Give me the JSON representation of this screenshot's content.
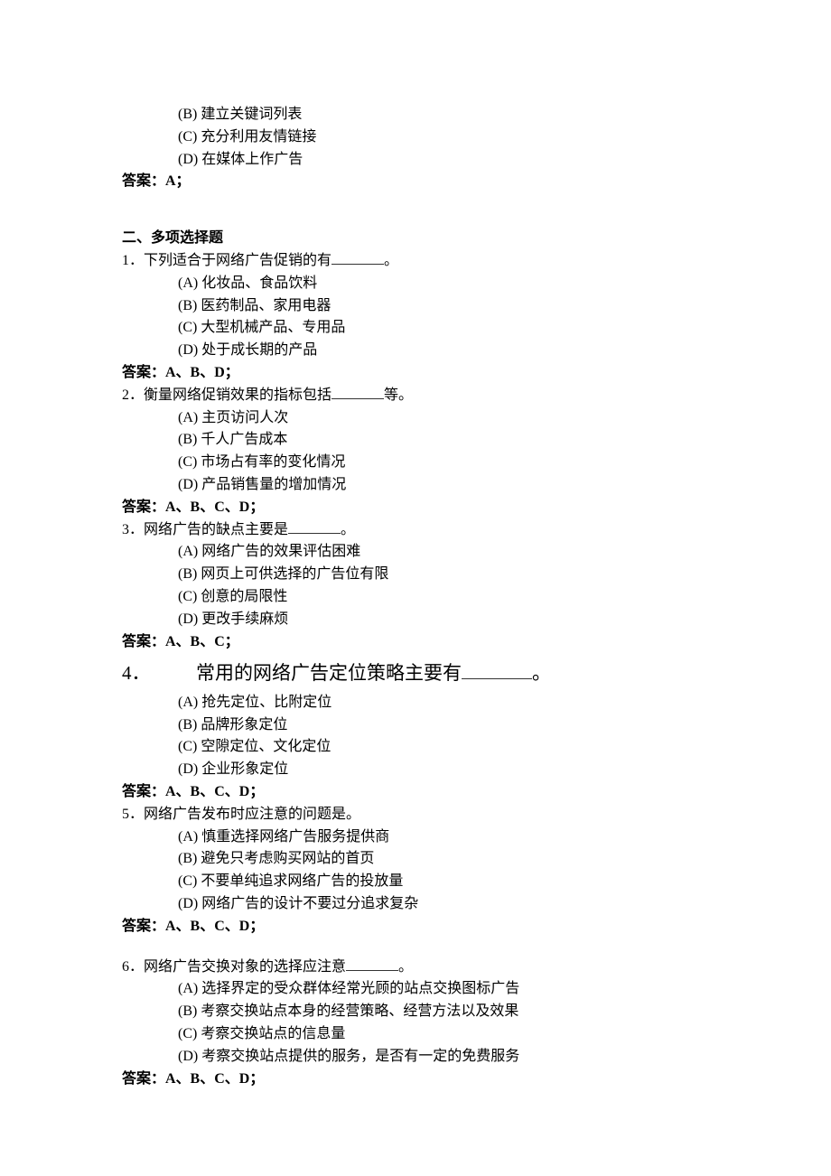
{
  "prev": {
    "options": {
      "B": "(B) 建立关键词列表",
      "C": "(C) 充分利用友情链接",
      "D": "(D) 在媒体上作广告"
    },
    "answer": "答案：A；"
  },
  "section2": {
    "title": "二、多项选择题",
    "q1": {
      "stem_pre": "1．下列适合于网络广告促销的有",
      "stem_post": "。",
      "options": {
        "A": "(A) 化妆品、食品饮料",
        "B": "(B) 医药制品、家用电器",
        "C": "(C) 大型机械产品、专用品",
        "D": "(D) 处于成长期的产品"
      },
      "answer": "答案：A、B、D；"
    },
    "q2": {
      "stem_pre": "2．衡量网络促销效果的指标包括",
      "stem_post": "等。",
      "options": {
        "A": "(A) 主页访问人次",
        "B": "(B) 千人广告成本",
        "C": "(C) 市场占有率的变化情况",
        "D": "(D) 产品销售量的增加情况"
      },
      "answer": "答案：A、B、C、D；"
    },
    "q3": {
      "stem_pre": "3．网络广告的缺点主要是",
      "stem_post": "。",
      "options": {
        "A": "(A) 网络广告的效果评估困难",
        "B": "(B) 网页上可供选择的广告位有限",
        "C": "(C) 创意的局限性",
        "D": "(D) 更改手续麻烦"
      },
      "answer": "答案：A、B、C；"
    },
    "q4": {
      "num": "4．",
      "stem_pre": "常用的网络广告定位策略主要有",
      "stem_post": "。",
      "options": {
        "A": "(A) 抢先定位、比附定位",
        "B": "(B) 品牌形象定位",
        "C": "(C) 空隙定位、文化定位",
        "D": "(D) 企业形象定位"
      },
      "answer": "答案：A、B、C、D；"
    },
    "q5": {
      "stem": "5．网络广告发布时应注意的问题是。",
      "options": {
        "A": "(A) 慎重选择网络广告服务提供商",
        "B": "(B) 避免只考虑购买网站的首页",
        "C": "(C) 不要单纯追求网络广告的投放量",
        "D": "(D) 网络广告的设计不要过分追求复杂"
      },
      "answer": "答案：A、B、C、D；"
    },
    "q6": {
      "stem_pre": "6．网络广告交换对象的选择应注意",
      "stem_post": "。",
      "options": {
        "A": "(A) 选择界定的受众群体经常光顾的站点交换图标广告",
        "B": "(B) 考察交换站点本身的经营策略、经营方法以及效果",
        "C": "(C) 考察交换站点的信息量",
        "D": "(D) 考察交换站点提供的服务，是否有一定的免费服务"
      },
      "answer": "答案：A、B、C、D；"
    }
  }
}
